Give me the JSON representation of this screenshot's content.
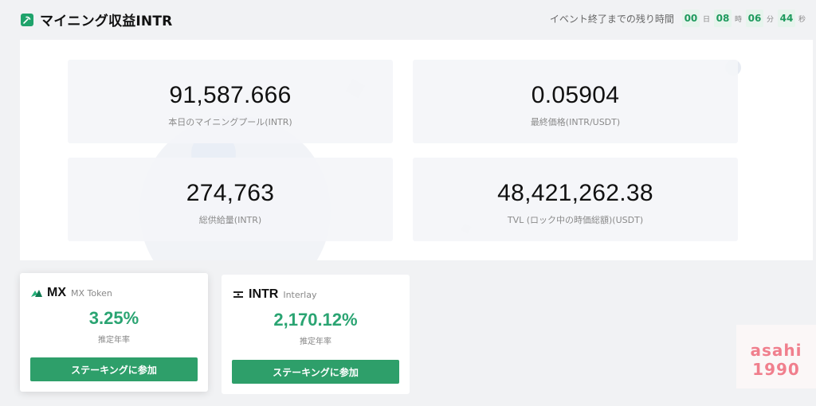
{
  "header": {
    "title": "マイニング収益INTR",
    "countdown": {
      "label": "イベント終了までの残り時間",
      "days": "00",
      "days_unit": "日",
      "hours": "08",
      "hours_unit": "時",
      "minutes": "06",
      "minutes_unit": "分",
      "seconds": "44",
      "seconds_unit": "秒"
    }
  },
  "stats": [
    {
      "value": "91,587.666",
      "label": "本日のマイニングプール(INTR)"
    },
    {
      "value": "0.05904",
      "label": "最終価格(INTR/USDT)"
    },
    {
      "value": "274,763",
      "label": "総供給量(INTR)"
    },
    {
      "value": "48,421,262.38",
      "label": "TVL (ロック中の時価総額)(USDT)"
    }
  ],
  "tokens": [
    {
      "symbol": "MX",
      "name": "MX Token",
      "apr": "3.25%",
      "apr_label": "推定年率",
      "button": "ステーキングに参加",
      "logo_icon": "mx-logo-icon"
    },
    {
      "symbol": "INTR",
      "name": "Interlay",
      "apr": "2,170.12%",
      "apr_label": "推定年率",
      "button": "ステーキングに参加",
      "logo_icon": "interlay-logo-icon"
    }
  ],
  "watermark": {
    "line1": "asahi",
    "line2": "1990"
  },
  "colors": {
    "accent": "#2aa472",
    "button": "#2e9f6a",
    "countdown_bg": "#e6f4ec",
    "watermark": "#f07f8d"
  }
}
